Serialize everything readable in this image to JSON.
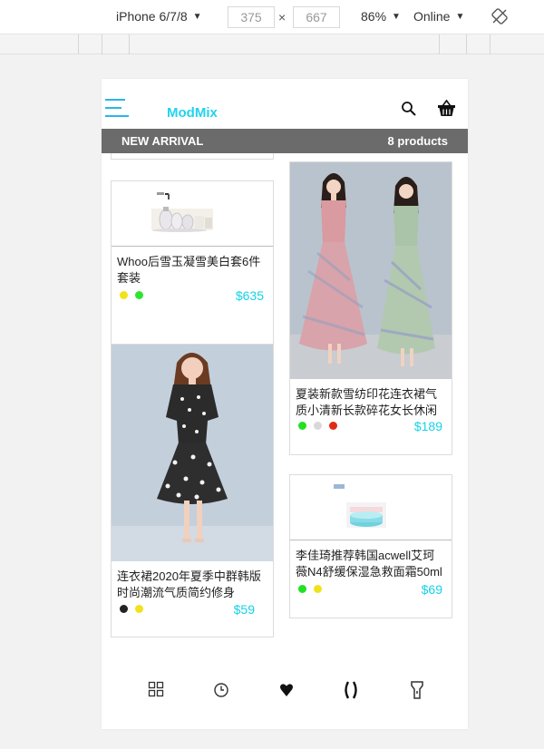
{
  "devtools": {
    "device": "iPhone 6/7/8",
    "width": "375",
    "times": "×",
    "height": "667",
    "zoom": "86%",
    "network": "Online"
  },
  "app": {
    "logo": "ModMix",
    "banner_left": "NEW ARRIVAL",
    "banner_right": "8 products"
  },
  "products": [
    {
      "title": "Whoo后雪玉凝雪美白套6件套装",
      "price": "$635",
      "colors": [
        "#f2e21a",
        "#2ee52e"
      ]
    },
    {
      "title": "夏装新款雪纺印花连衣裙气质小清新长款碎花女长休闲",
      "price": "$189",
      "colors": [
        "#22e022",
        "#d8d8d8",
        "#e02b12"
      ]
    },
    {
      "title": "连衣裙2020年夏季中群韩版时尚潮流气质简约修身",
      "price": "$59",
      "colors": [
        "#222222",
        "#f2e21a"
      ]
    },
    {
      "title": "李佳琦推荐韩国acwell艾珂薇N4舒缓保湿急救面霜50ml",
      "price": "$69",
      "colors": [
        "#22e022",
        "#f2e21a"
      ]
    }
  ],
  "icons": {
    "menu": "hamburger-icon",
    "search": "search-icon",
    "cart": "basket-icon",
    "nav": [
      "grid-icon",
      "clock-icon",
      "heart-icon",
      "brackets-icon",
      "flashlight-icon"
    ]
  },
  "colors": {
    "accent": "#22d3ee",
    "banner": "#6b6b6b",
    "price": "#14d3e6"
  }
}
